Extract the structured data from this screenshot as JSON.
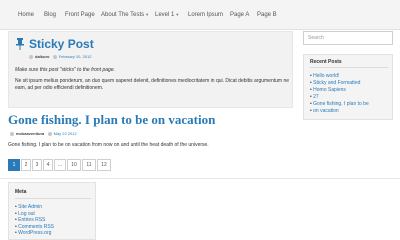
{
  "nav": {
    "items": [
      "Home",
      "Blog",
      "Front Page",
      "About The Tests",
      "Level 1",
      "Lorem Ipsum",
      "Page A",
      "Page B"
    ]
  },
  "sticky_post": {
    "title": "Sticky Post",
    "author": "dalkuro",
    "date": "February 10, 2012",
    "intro": "Make sure this post \"sticks\" to the front page.",
    "body": "Ne sit ipsum melius ponderum, an duo quem saperet delenit, definitiones mediocritatem in qui. Dicat debitis argumentum ne eam, ad per odio efficiendi definitionem."
  },
  "post": {
    "title": "Gone fishing. I plan to be on vacation",
    "author": "mokaavenitura",
    "date": "May 22 2012",
    "body": "Gone fishing. I plan to be on vacation from now on and until the heat death of the universe."
  },
  "pagination": [
    "1",
    "2",
    "3",
    "4",
    "...",
    "10",
    "11",
    "12"
  ],
  "search": {
    "placeholder": "Search"
  },
  "recent_posts": {
    "title": "Recent Posts",
    "items": [
      "Hello world!",
      "Sticky and Formatted",
      "Homo Sapiens",
      "27",
      "Gone fishing. I plan to be",
      "on vacation"
    ]
  },
  "meta_widget": {
    "title": "Meta",
    "items": [
      "Site Admin",
      "Log out",
      "Entries RSS",
      "Comments RSS",
      "WordPress.org"
    ]
  },
  "colors": {
    "accent": "#2a7ab8",
    "background": "#ffffff",
    "panel": "#f4f4f4"
  }
}
